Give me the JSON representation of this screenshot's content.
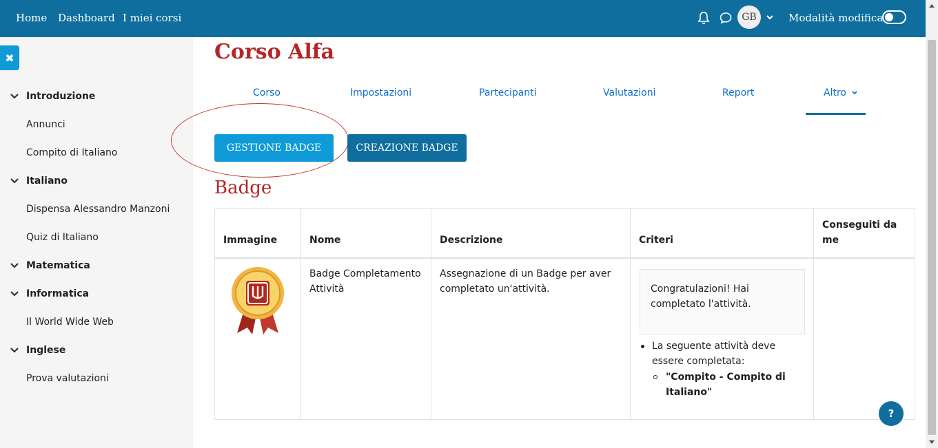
{
  "navbar": {
    "links": [
      "Home",
      "Dashboard",
      "I miei corsi"
    ],
    "avatar_initials": "GB",
    "edit_mode_label": "Modalità modifica",
    "bg_color": "#0f6e9e"
  },
  "sidebar": {
    "close_icon": "close-icon",
    "sections": [
      {
        "title": "Introduzione",
        "items": [
          "Annunci",
          "Compito di Italiano"
        ]
      },
      {
        "title": "Italiano",
        "items": [
          "Dispensa Alessandro Manzoni",
          "Quiz di Italiano"
        ]
      },
      {
        "title": "Matematica",
        "items": []
      },
      {
        "title": "Informatica",
        "items": [
          "Il World Wide Web"
        ]
      },
      {
        "title": "Inglese",
        "items": [
          "Prova valutazioni"
        ]
      }
    ]
  },
  "course": {
    "title": "Corso Alfa",
    "tabs": [
      "Corso",
      "Impostazioni",
      "Partecipanti",
      "Valutazioni",
      "Report",
      "Altro"
    ]
  },
  "actions": {
    "manage_badges": "GESTIONE BADGE",
    "create_badge": "CREAZIONE BADGE"
  },
  "badges": {
    "heading": "Badge",
    "columns": [
      "Immagine",
      "Nome",
      "Descrizione",
      "Criteri",
      "Conseguiti da me"
    ],
    "rows": [
      {
        "name": "Badge Completamento Attività",
        "description": "Assegnazione di un Badge per aver completato un'attività.",
        "criteria_message": "Congratulazioni! Hai completato l'attività.",
        "criteria_rule": "La seguente attività deve essere completata:",
        "criteria_activity": "\"Compito - Compito di Italiano\"",
        "earned": ""
      }
    ]
  },
  "help_label": "?"
}
